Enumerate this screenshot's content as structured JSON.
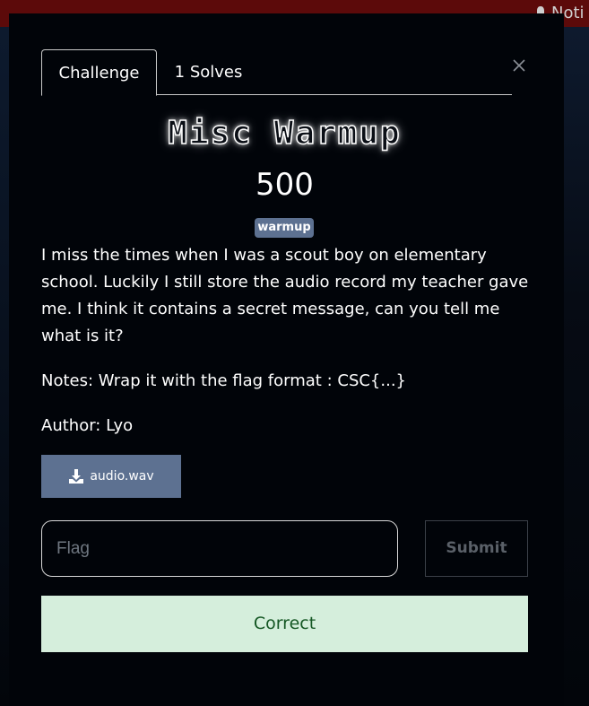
{
  "header": {
    "notification_label": "Noti"
  },
  "modal": {
    "tabs": [
      {
        "label": "Challenge"
      },
      {
        "label": "1 Solves"
      }
    ],
    "challenge": {
      "title": "Misc Warmup",
      "value": "500",
      "tag": "warmup",
      "description": [
        "I miss the times when I was a scout boy on elementary school. Luckily I still store the audio record my teacher gave me. I think it contains a secret message, can you tell me what is it?",
        "Notes: Wrap it with the flag format : CSC{...}",
        "Author: Lyo"
      ],
      "file": {
        "label": "audio.wav",
        "icon": "download-icon"
      }
    },
    "form": {
      "flag_placeholder": "Flag",
      "flag_value": "",
      "submit_label": "Submit",
      "result": "Correct"
    }
  },
  "colors": {
    "modal_bg": "#010409",
    "topbar": "#5c0a0a",
    "accent": "#5d7191",
    "success_bg": "#d5eedc",
    "success_text": "#155724"
  }
}
